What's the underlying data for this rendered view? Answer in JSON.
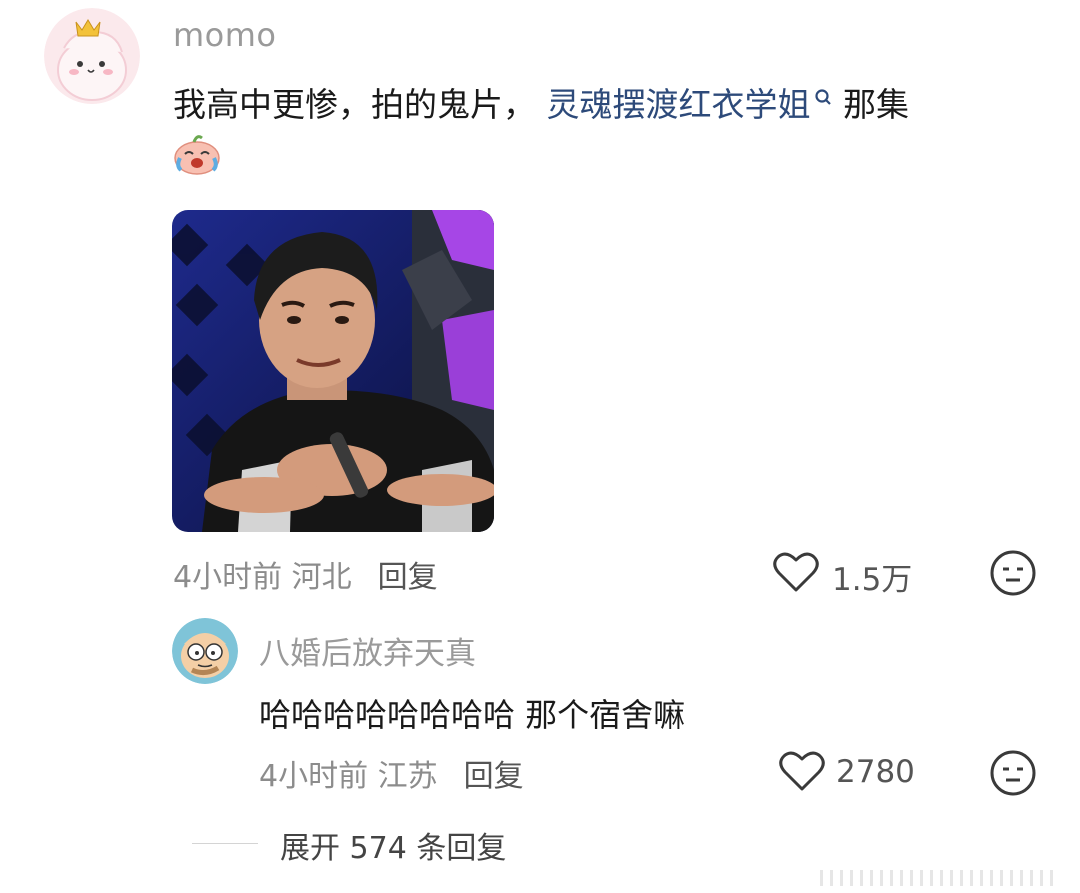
{
  "comment": {
    "username": "momo",
    "text_before": "我高中更惨，拍的鬼片，",
    "tag": "灵魂摆渡红衣学姐",
    "text_after": "那集",
    "time": "4小时前",
    "location": "河北",
    "reply_label": "回复",
    "like_count": "1.5万"
  },
  "reply": {
    "username": "八婚后放弃天真",
    "text": "哈哈哈哈哈哈哈哈 那个宿舍嘛",
    "time": "4小时前",
    "location": "江苏",
    "reply_label": "回复",
    "like_count": "2780"
  },
  "expand": {
    "label": "展开 574 条回复"
  },
  "colors": {
    "tag_link": "#2d4a7a",
    "meta_gray": "#8c8c8c",
    "name_gray": "#9a9a9a"
  },
  "icons": [
    "crown-avatar",
    "crying-emoji",
    "heart-icon",
    "meh-face-icon",
    "search-mark-icon"
  ]
}
